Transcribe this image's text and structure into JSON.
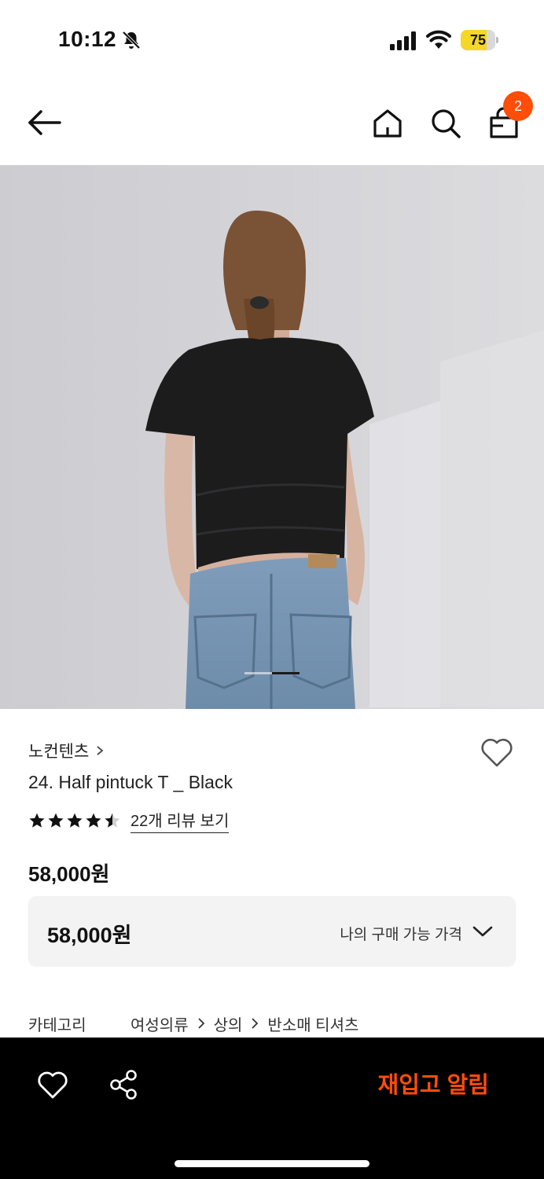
{
  "status_bar": {
    "time": "10:12",
    "battery_level": "75",
    "battery_fraction": 0.75,
    "battery_color": "#f5d62a"
  },
  "header": {
    "icons": [
      "back-arrow-icon",
      "home-icon",
      "search-icon",
      "shopping-bag-icon"
    ],
    "cart_count": "2",
    "badge_color": "#ff4d0a"
  },
  "hero": {
    "image": "photo of model from behind wearing black short-sleeve pintuck t-shirt and light blue jeans",
    "slide_index": 2,
    "slide_count": 2
  },
  "product": {
    "brand": "노컨텐츠",
    "name": "24. Half pintuck T _ Black",
    "rating": 4.5,
    "review_link": "22개 리뷰 보기",
    "price": "58,000원",
    "price_box": {
      "price": "58,000원",
      "label": "나의 구매 가능 가격"
    },
    "category": {
      "label": "카테고리",
      "path": [
        "여성의류",
        "상의",
        "반소매 티셔츠"
      ]
    }
  },
  "bottom_bar": {
    "restock_label": "재입고 알림",
    "accent_color": "#ff4d0a",
    "icons": [
      "heart-icon",
      "share-icon"
    ]
  }
}
